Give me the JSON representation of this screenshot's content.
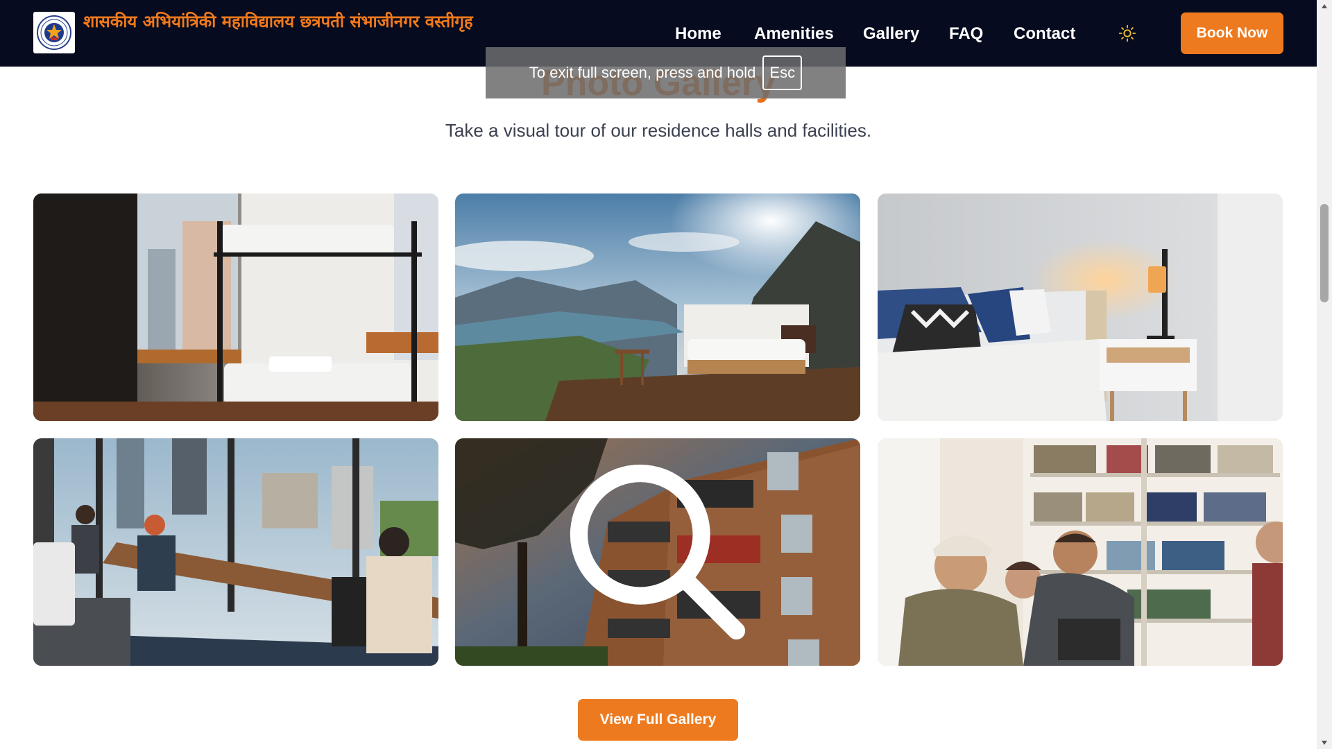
{
  "header": {
    "title": "शासकीय अभियांत्रिकी महाविद्यालय छत्रपती संभाजीनगर वस्तीगृह",
    "nav": [
      "Home",
      "Amenities",
      "Gallery",
      "FAQ",
      "Contact"
    ],
    "theme_icon": "sun-icon",
    "book_label": "Book Now"
  },
  "fullscreen_notice": {
    "text": "To exit full screen, press and hold",
    "key": "Esc"
  },
  "gallery": {
    "title": "Photo Gallery",
    "subtitle": "Take a visual tour of our residence halls and facilities.",
    "tiles": [
      {
        "icon": "bunk-bed-dorm-photo"
      },
      {
        "icon": "mountain-lake-bedroom-photo"
      },
      {
        "icon": "bedroom-lamp-photo"
      },
      {
        "icon": "coworking-space-photo"
      },
      {
        "icon": "apartment-building-photo",
        "hover_icon": "search-icon"
      },
      {
        "icon": "students-library-photo"
      }
    ],
    "button_label": "View Full Gallery"
  },
  "colors": {
    "accent": "#ee7a1f",
    "navbar": "#060b1f",
    "brand_text": "#f07a1c"
  }
}
